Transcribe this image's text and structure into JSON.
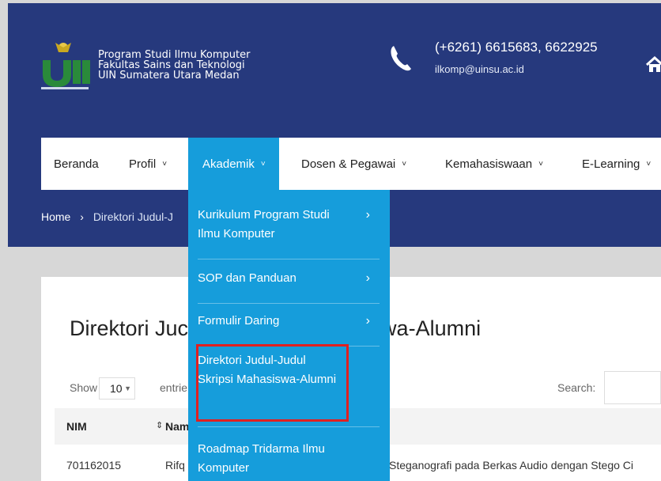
{
  "header": {
    "brand_lines": [
      "Program Studi Ilmu Komputer",
      "Fakultas Sains dan Teknologi",
      "UIN Sumatera Utara Medan"
    ],
    "phone": "(+6261) 6615683, 6622925",
    "email": "ilkomp@uinsu.ac.id"
  },
  "nav": {
    "items": [
      {
        "label": "Beranda"
      },
      {
        "label": "Profil"
      },
      {
        "label": "Akademik"
      },
      {
        "label": "Dosen & Pegawai"
      },
      {
        "label": "Kemahasiswaan"
      },
      {
        "label": "E-Learning"
      }
    ],
    "chevron": "˅"
  },
  "breadcrumb": {
    "home": "Home",
    "separator": "›",
    "current": "Direktori Judul-J"
  },
  "page": {
    "title_left": "Direktori Juc",
    "title_right": "isiswa-Alumni"
  },
  "table_controls": {
    "show_label": "Show",
    "page_size": "10",
    "entries_label": "entrie",
    "search_label": "Search:"
  },
  "table": {
    "headers": [
      "NIM",
      "Nam"
    ],
    "rows": [
      {
        "nim": "701162015",
        "name": "Rifq",
        "title": "Steganografi pada Berkas Audio dengan Stego Ci"
      }
    ]
  },
  "dropdown": {
    "items": [
      {
        "label": "Kurikulum Program Studi Ilmu Komputer",
        "has_arrow": true
      },
      {
        "label": "SOP dan Panduan",
        "has_arrow": true
      },
      {
        "label": "Formulir Daring",
        "has_arrow": true
      },
      {
        "label": "Direktori Judul-Judul Skripsi Mahasiswa-Alumni",
        "has_arrow": false
      },
      {
        "label": "Roadmap Tridarma Ilmu Komputer",
        "has_arrow": false
      }
    ],
    "arrow": "›"
  },
  "colors": {
    "header_bg": "#26397d",
    "accent": "#169ddb",
    "highlight": "#e02020"
  }
}
